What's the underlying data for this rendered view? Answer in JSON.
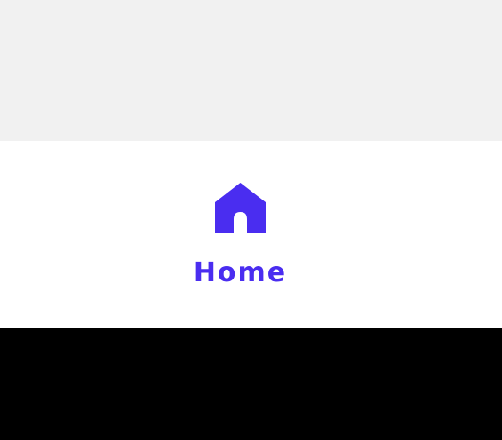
{
  "nav": {
    "item": {
      "label": "Home",
      "icon": "home-icon",
      "color": "#4a2df0"
    }
  },
  "colors": {
    "top_area": "#f1f1f1",
    "nav_bar": "#ffffff",
    "bottom_bar": "#000000"
  }
}
